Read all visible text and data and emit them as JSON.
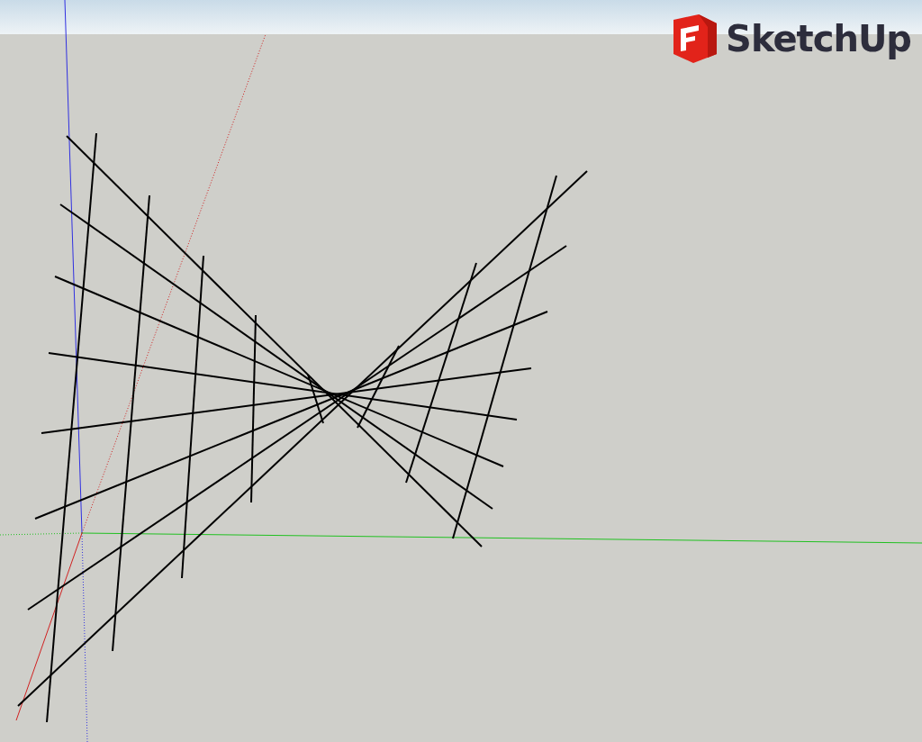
{
  "logo": {
    "text": "SketchUp"
  }
}
